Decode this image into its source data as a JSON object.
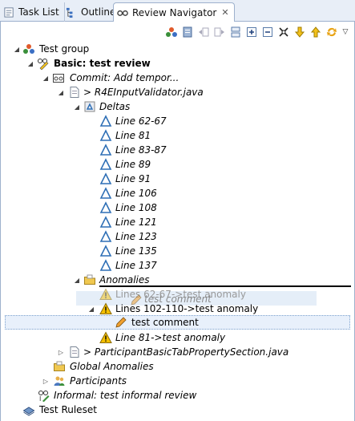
{
  "tabs": [
    {
      "label": "Task List",
      "icon": "task-list-icon"
    },
    {
      "label": "Outline",
      "icon": "outline-icon"
    },
    {
      "label": "Review Navigator",
      "icon": "review-navigator-icon",
      "close": "✕"
    }
  ],
  "toolbar": {
    "buttons": [
      "show-participants-icon",
      "show-properties-icon",
      "previous-icon",
      "next-icon",
      "collapse-all-icon",
      "expand-all-icon",
      "zoom-in-icon",
      "focus-icon",
      "move-down-icon",
      "move-up-icon",
      "sync-icon"
    ],
    "menu": "▽"
  },
  "tree": {
    "test_group": "Test group",
    "basic_review": "Basic: test review",
    "commit": "Commit: Add tempor...",
    "file1": "> R4EInputValidator.java",
    "deltas": "Deltas",
    "lines": [
      "Line 62-67",
      "Line 81",
      "Line 83-87",
      "Line 89",
      "Line 91",
      "Line 106",
      "Line 108",
      "Line 121",
      "Line 123",
      "Line 135",
      "Line 137"
    ],
    "anomalies": "Anomalies",
    "anomaly1": "Lines 62-67->test anomaly",
    "drag_comment": "test comment",
    "anomaly2": "Lines 102-110->test anomaly",
    "comment": "test comment",
    "anomaly3": "Line 81->test anomaly",
    "file2": "> ParticipantBasicTabPropertySection.java",
    "global_anomalies": "Global Anomalies",
    "participants": "Participants",
    "informal_review": "Informal: test informal review",
    "test_ruleset": "Test Ruleset"
  },
  "colors": {
    "tab_bg": "#e8eef7",
    "frame_border": "#9eb1cd",
    "delta_blue": "#2e6fb5",
    "warning_yellow": "#f5c000",
    "folder_yellow": "#f0c850"
  }
}
